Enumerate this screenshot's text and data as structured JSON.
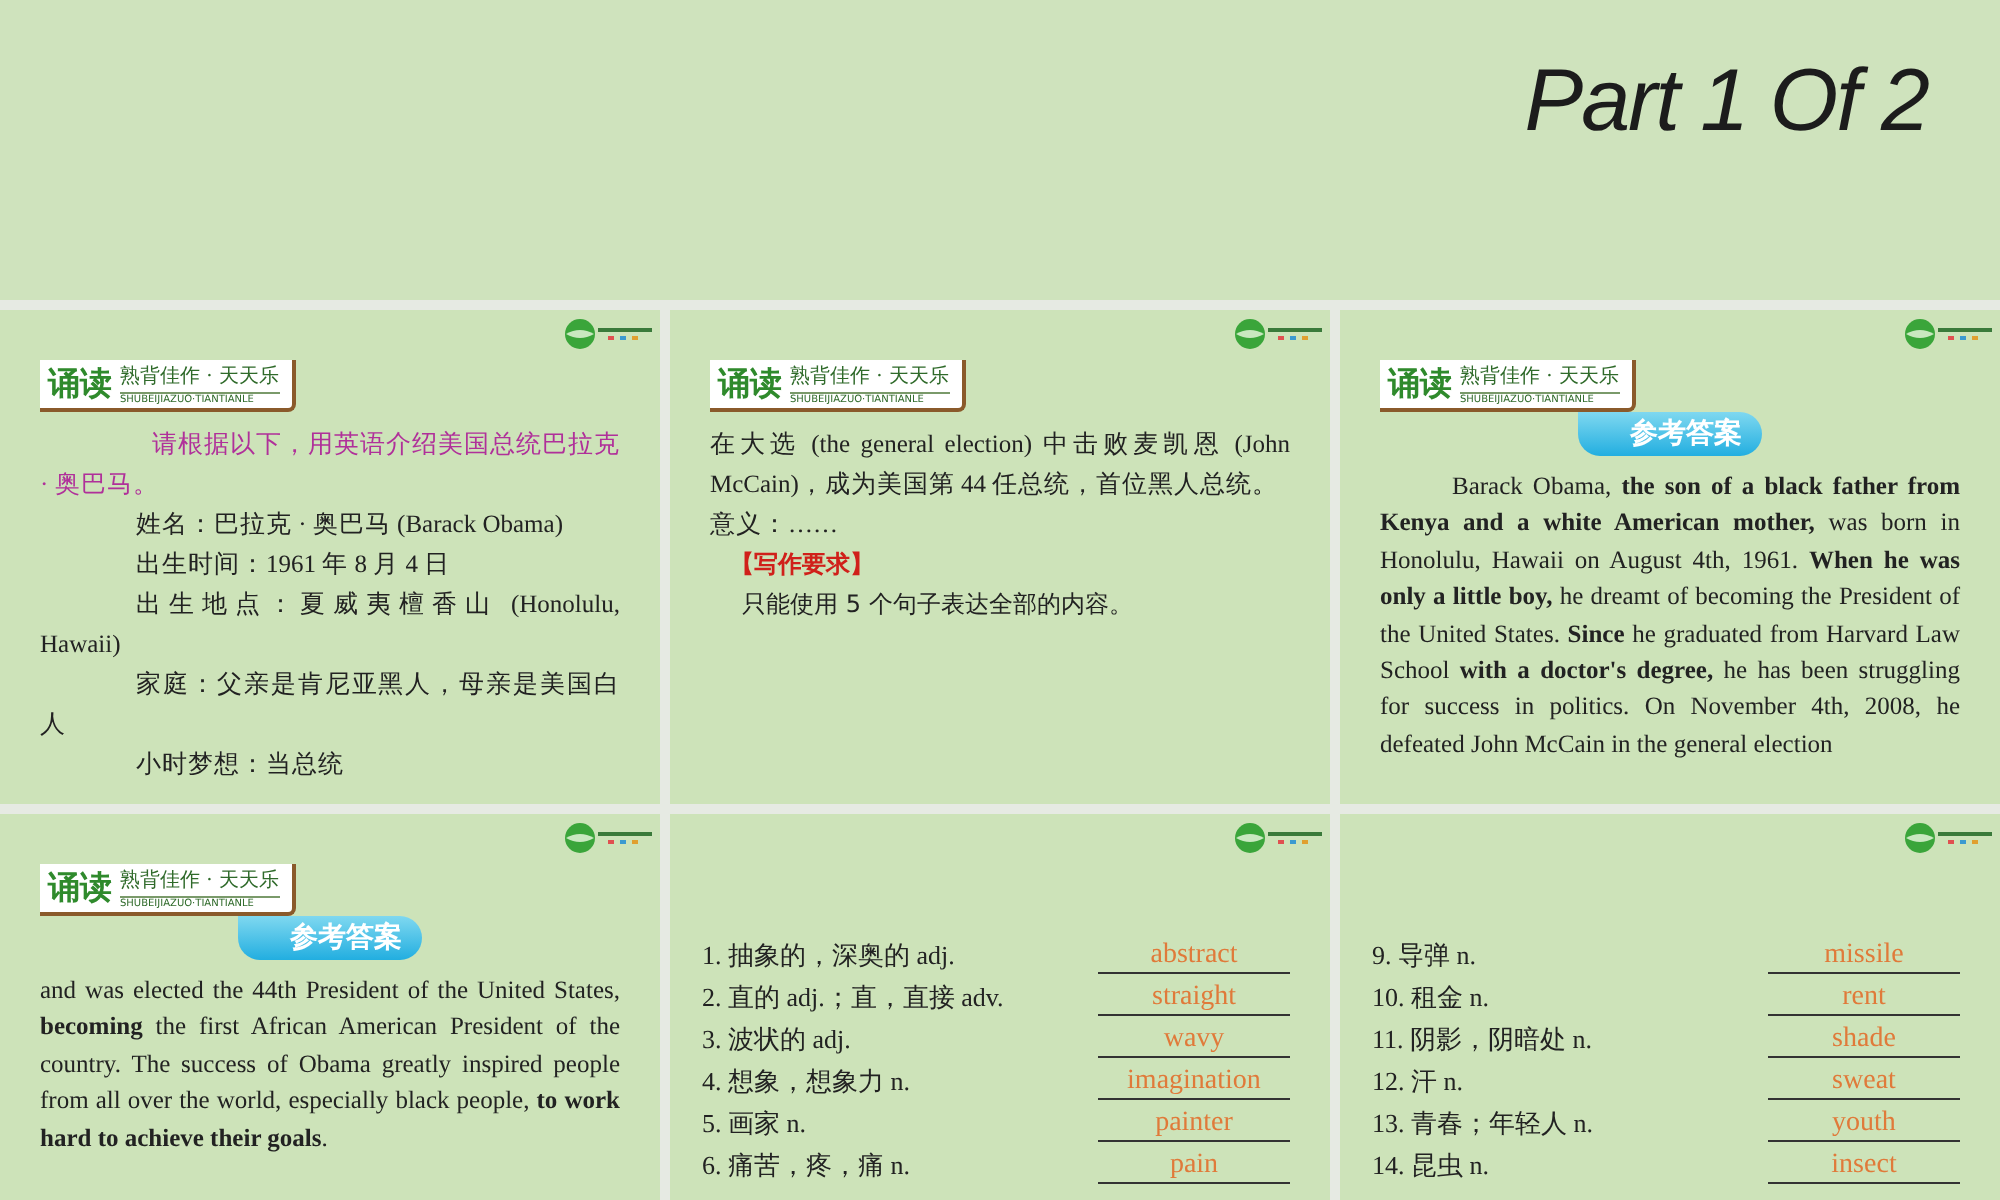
{
  "header": {
    "title": "Part 1 Of 2"
  },
  "slides": [
    {
      "kind": "text",
      "badge": {
        "title": "诵读",
        "subtitle": "熟背佳作 · 天天乐",
        "pinyin": "SHUBEIJIAZUO·TIANTIANLE"
      },
      "paragraphs": [
        {
          "kind": "lead",
          "text": "请根据以下，用英语介绍美国总统巴拉克 · 奥巴马。"
        },
        {
          "kind": "line",
          "text": "姓名：巴拉克 · 奥巴马  (Barack Obama)"
        },
        {
          "kind": "line",
          "text": "出生时间：1961 年 8 月 4 日"
        },
        {
          "kind": "line",
          "text": "出生地点：夏威夷檀香山 (Honolulu, Hawaii)"
        },
        {
          "kind": "line",
          "text": "家庭：父亲是肯尼亚黑人，母亲是美国白人"
        },
        {
          "kind": "line",
          "text": "小时梦想：当总统"
        }
      ]
    },
    {
      "kind": "text",
      "badge": {
        "title": "诵读",
        "subtitle": "熟背佳作 · 天天乐",
        "pinyin": "SHUBEIJIAZUO·TIANTIANLE"
      },
      "paragraphs": [
        {
          "kind": "plain",
          "text": "在大选 (the general election) 中击败麦凯恩 (John McCain)，成为美国第 44 任总统，首位黑人总统。"
        },
        {
          "kind": "plain",
          "text": "意义：……"
        },
        {
          "kind": "heading",
          "text": "【写作要求】"
        },
        {
          "kind": "note",
          "text": "只能使用 5 个句子表达全部的内容。"
        }
      ]
    },
    {
      "kind": "text",
      "badge": {
        "title": "诵读",
        "subtitle": "熟背佳作 · 天天乐",
        "pinyin": "SHUBEIJIAZUO·TIANTIANLE"
      },
      "answer_tag": "参考答案",
      "paragraphs": [
        {
          "kind": "answer",
          "text": "Barack Obama, **the son of a black father from Kenya and a white American mother,** was born in Honolulu, Hawaii on August 4th, 1961. **When he was only a little boy,** he dreamt of becoming the President of the United States. **Since** he graduated from Harvard Law School **with a doctor's degree,** he has been struggling for success in politics. On November 4th, 2008, he defeated John McCain in the general election"
        }
      ]
    },
    {
      "kind": "text",
      "badge": {
        "title": "诵读",
        "subtitle": "熟背佳作 · 天天乐",
        "pinyin": "SHUBEIJIAZUO·TIANTIANLE"
      },
      "answer_tag": "参考答案",
      "paragraphs": [
        {
          "kind": "answer_cont",
          "text": "and was elected the 44th President of the United States, **becoming** the first African American President of the country. The success of Obama greatly inspired people from all over the world, especially black people, **to work hard to achieve their goals**."
        }
      ]
    },
    {
      "kind": "vocab",
      "items": [
        {
          "term": "1. 抽象的，深奥的  adj.",
          "answer": "abstract"
        },
        {
          "term": "2. 直的  adj.；直，直接  adv.",
          "answer": "straight"
        },
        {
          "term": "3. 波状的  adj.",
          "answer": "wavy"
        },
        {
          "term": "4. 想象，想象力  n.",
          "answer": "imagination"
        },
        {
          "term": "5. 画家  n.",
          "answer": "painter"
        },
        {
          "term": "6. 痛苦，疼，痛  n.",
          "answer": "pain"
        }
      ]
    },
    {
      "kind": "vocab",
      "items": [
        {
          "term": "9.  导弹  n.",
          "answer": "missile"
        },
        {
          "term": "10. 租金  n.",
          "answer": "rent"
        },
        {
          "term": "11. 阴影，阴暗处  n.",
          "answer": "shade"
        },
        {
          "term": "12. 汗  n.",
          "answer": "sweat"
        },
        {
          "term": "13. 青春；年轻人  n.",
          "answer": "youth"
        },
        {
          "term": "14. 昆虫  n.",
          "answer": "insect"
        }
      ]
    }
  ]
}
